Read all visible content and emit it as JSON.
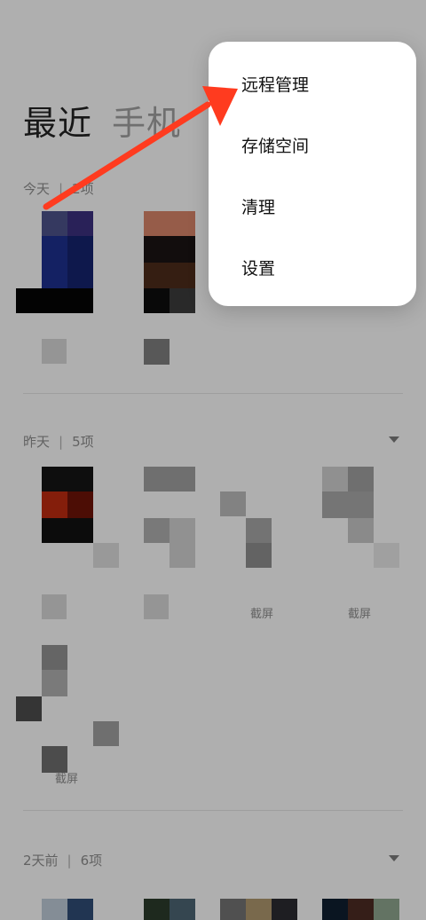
{
  "tabs": {
    "recent": "最近",
    "phone": "手机"
  },
  "sections": [
    {
      "day": "今天",
      "count": "2项"
    },
    {
      "day": "昨天",
      "count": "5项",
      "labels": [
        "截屏",
        "截屏",
        "截屏"
      ]
    },
    {
      "day": "2天前",
      "count": "6项"
    }
  ],
  "menu": {
    "items": [
      "远程管理",
      "存储空间",
      "清理",
      "设置"
    ]
  },
  "annotation": {
    "arrow_color": "#ff3b1f"
  }
}
